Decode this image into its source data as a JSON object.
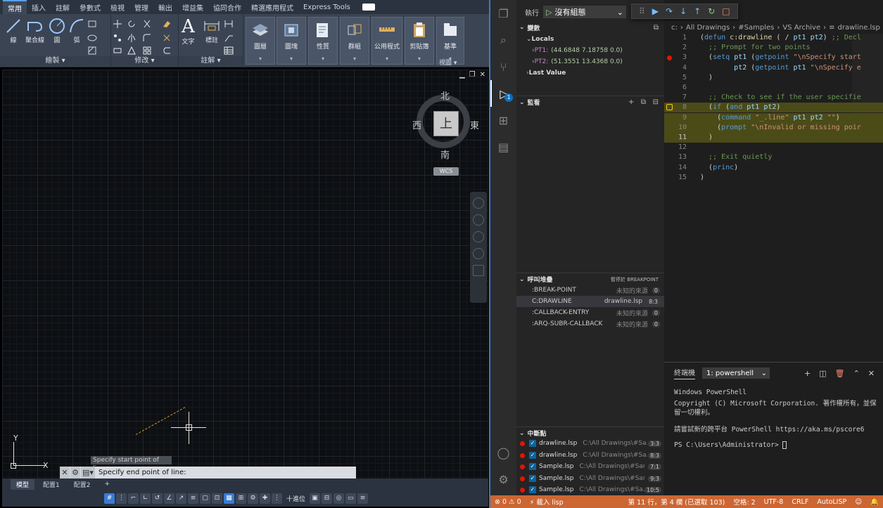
{
  "acad": {
    "tabs": [
      "常用",
      "插入",
      "註解",
      "參數式",
      "檢視",
      "管理",
      "輸出",
      "增益集",
      "協同合作",
      "精選應用程式",
      "Express Tools"
    ],
    "panels": {
      "draw": "繪製",
      "modify": "修改",
      "annotation": "註解",
      "draw_tools": [
        "線",
        "聚合線",
        "圓",
        "弧"
      ],
      "text_tool": "文字",
      "dim_tool": "標註",
      "big": [
        "圖層",
        "圖塊",
        "性質",
        "群組",
        "公用程式",
        "剪貼簿",
        "基準"
      ],
      "view": "視圖"
    },
    "viewcube": {
      "north": "北",
      "south": "南",
      "east": "東",
      "west": "西",
      "top": "上",
      "wcs": "WCS"
    },
    "ucs": {
      "x": "X",
      "y": "Y"
    },
    "prompt_history": "Specify start point of line:",
    "command_prompt": "Specify end point of line:",
    "layout_tabs": [
      "模型",
      "配置1",
      "配置2"
    ],
    "status_units": "十進位"
  },
  "vscode": {
    "debug": {
      "run_label": "執行",
      "config": "沒有組態",
      "variables_title": "變數",
      "locals_label": "Locals",
      "vars": [
        {
          "name": "PT1:",
          "value": "(44.6848 7.18758 0.0)"
        },
        {
          "name": "PT2:",
          "value": "(51.3551 13.4368 0.0)"
        }
      ],
      "last_value": "Last Value",
      "watch_title": "監看",
      "callstack_title": "呼叫堆疊",
      "callstack_status": "暫停於 BREAKPOINT",
      "stack": [
        {
          "name": ":BREAK-POINT",
          "src": "未知的來源",
          "pos": "0"
        },
        {
          "name": "C:DRAWLINE",
          "src": "drawline.lsp",
          "pos": "8:3"
        },
        {
          "name": ":CALLBACK-ENTRY",
          "src": "未知的來源",
          "pos": "0"
        },
        {
          "name": ":ARQ-SUBR-CALLBACK",
          "src": "未知的來源",
          "pos": "0"
        }
      ],
      "breakpoints_title": "中斷點",
      "breakpoints": [
        {
          "file": "drawline.lsp",
          "path": "C:\\All Drawings\\#Sa...",
          "line": "3:3"
        },
        {
          "file": "drawline.lsp",
          "path": "C:\\All Drawings\\#Sa...",
          "line": "8:3"
        },
        {
          "file": "Sample.lsp",
          "path": "C:\\All Drawings\\#Sam...",
          "line": "7:1"
        },
        {
          "file": "Sample.lsp",
          "path": "C:\\All Drawings\\#Sam...",
          "line": "9:3"
        },
        {
          "file": "Sample.lsp",
          "path": "C:\\All Drawings\\#Sa...",
          "line": "10:5"
        }
      ]
    },
    "breadcrumb": [
      "c:",
      "All Drawings",
      "#Samples",
      "VS Archive",
      "drawline.lsp"
    ],
    "code": [
      "(defun c:drawline ( / pt1 pt2) ;; Decl",
      "  ;; Prompt for two points",
      "  (setq pt1 (getpoint \"\\nSpecify start",
      "        pt2 (getpoint pt1 \"\\nSpecify e",
      "  )",
      "",
      "  ;; Check to see if the user specifie",
      "  (if (and pt1 pt2)",
      "    (command \"_.line\" pt1 pt2 \"\")",
      "    (prompt \"\\nInvalid or missing poir",
      "  )",
      "",
      "  ;; Exit quietly",
      "  (princ)",
      ")"
    ],
    "terminal": {
      "title": "終端機",
      "shell": "1: powershell",
      "lines": [
        "Windows PowerShell",
        "Copyright (C) Microsoft Corporation. 著作權所有，並保",
        "留一切權利。",
        "",
        "請嘗試新的跨平台 PowerShell https://aka.ms/pscore6",
        "",
        "PS C:\\Users\\Administrator> "
      ]
    },
    "status": {
      "errors": "0",
      "warnings": "0",
      "mode": "載入 lisp",
      "position": "第 11 行，第 4 欄 (已選取 103)",
      "spaces": "空格: 2",
      "encoding": "UTF-8",
      "eol": "CRLF",
      "lang": "AutoLISP"
    }
  }
}
